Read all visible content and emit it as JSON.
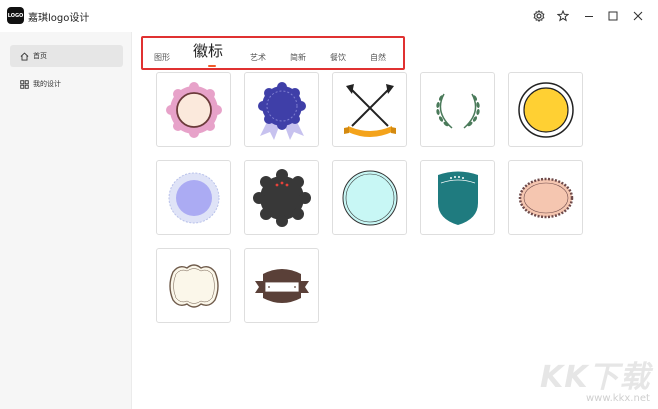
{
  "app": {
    "logo_text": "LOGO",
    "title": "嘉琪logo设计"
  },
  "titlebar": {
    "buttons": [
      "gear-icon",
      "star-icon",
      "minimize-icon",
      "maximize-icon",
      "close-icon"
    ]
  },
  "sidebar": {
    "items": [
      {
        "label": "首页",
        "icon": "home-icon",
        "active": true
      },
      {
        "label": "我的设计",
        "icon": "grid-icon",
        "active": false
      }
    ]
  },
  "tabs": [
    {
      "label": "图形",
      "active": false
    },
    {
      "label": "徽标",
      "active": true
    },
    {
      "label": "艺术",
      "active": false
    },
    {
      "label": "简新",
      "active": false
    },
    {
      "label": "餐饮",
      "active": false
    },
    {
      "label": "自然",
      "active": false
    }
  ],
  "colors": {
    "accent": "#e03131",
    "tab_indicator": "#f05a28"
  },
  "badges": [
    {
      "name": "pink-scalloped-badge",
      "colors": [
        "#e7a2c9",
        "#fbe9dc",
        "#6b3a3a"
      ]
    },
    {
      "name": "blue-rosette-ribbon-badge",
      "colors": [
        "#3f3fa8",
        "#c7c2ef"
      ]
    },
    {
      "name": "crossed-axes-banner-badge",
      "colors": [
        "#222222",
        "#f4a31b"
      ]
    },
    {
      "name": "laurel-wreath-badge",
      "colors": [
        "#4a7a5a"
      ]
    },
    {
      "name": "yellow-ring-badge",
      "colors": [
        "#ffd033",
        "#222222"
      ]
    },
    {
      "name": "lavender-circle-badge",
      "colors": [
        "#ababf3",
        "#dfe3f7"
      ]
    },
    {
      "name": "dark-scalloped-badge",
      "colors": [
        "#383838",
        "#e8423a"
      ]
    },
    {
      "name": "mint-circle-badge",
      "colors": [
        "#c8f7f5",
        "#333333"
      ]
    },
    {
      "name": "teal-shield-badge",
      "colors": [
        "#1f7b7f",
        "#ffffff"
      ]
    },
    {
      "name": "peach-oval-badge",
      "colors": [
        "#f5c6b0",
        "#6e4a4a"
      ]
    },
    {
      "name": "cream-ornate-frame-badge",
      "colors": [
        "#fbf7ea",
        "#6e5a4a"
      ]
    },
    {
      "name": "brown-banner-badge",
      "colors": [
        "#5a4038",
        "#ffffff"
      ]
    }
  ],
  "watermark": {
    "text": "KK下载",
    "url": "www.kkx.net"
  }
}
